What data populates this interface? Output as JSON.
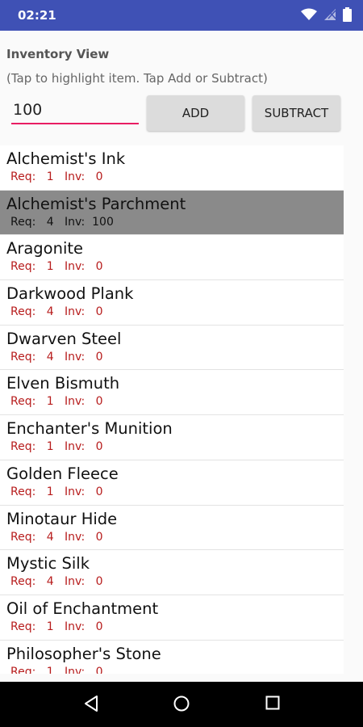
{
  "status": {
    "time": "02:21"
  },
  "header": {
    "title": "Inventory View",
    "hint": "(Tap to highlight item.  Tap Add or Subtract)"
  },
  "controls": {
    "quantity_value": "100",
    "add_label": "ADD",
    "subtract_label": "SUBTRACT"
  },
  "labels": {
    "req": "Req:",
    "inv": "Inv:"
  },
  "items": [
    {
      "name": "Alchemist's Ink",
      "req": "1",
      "inv": "0",
      "selected": false
    },
    {
      "name": "Alchemist's Parchment",
      "req": "4",
      "inv": "100",
      "selected": true
    },
    {
      "name": "Aragonite",
      "req": "1",
      "inv": "0",
      "selected": false
    },
    {
      "name": "Darkwood Plank",
      "req": "4",
      "inv": "0",
      "selected": false
    },
    {
      "name": "Dwarven Steel",
      "req": "4",
      "inv": "0",
      "selected": false
    },
    {
      "name": "Elven Bismuth",
      "req": "1",
      "inv": "0",
      "selected": false
    },
    {
      "name": "Enchanter's Munition",
      "req": "1",
      "inv": "0",
      "selected": false
    },
    {
      "name": "Golden Fleece",
      "req": "1",
      "inv": "0",
      "selected": false
    },
    {
      "name": "Minotaur Hide",
      "req": "4",
      "inv": "0",
      "selected": false
    },
    {
      "name": "Mystic Silk",
      "req": "4",
      "inv": "0",
      "selected": false
    },
    {
      "name": "Oil of Enchantment",
      "req": "1",
      "inv": "0",
      "selected": false
    },
    {
      "name": "Philosopher's Stone",
      "req": "1",
      "inv": "0",
      "selected": false
    }
  ],
  "colors": {
    "status_bar": "#3f51b5",
    "accent": "#e91e63",
    "selected_row": "#8a8a8a",
    "meta_text": "#b71c1c"
  },
  "icons": {
    "status": [
      "wifi-icon",
      "signal-icon",
      "battery-icon"
    ],
    "nav": [
      "back-icon",
      "home-icon",
      "recents-icon"
    ]
  }
}
